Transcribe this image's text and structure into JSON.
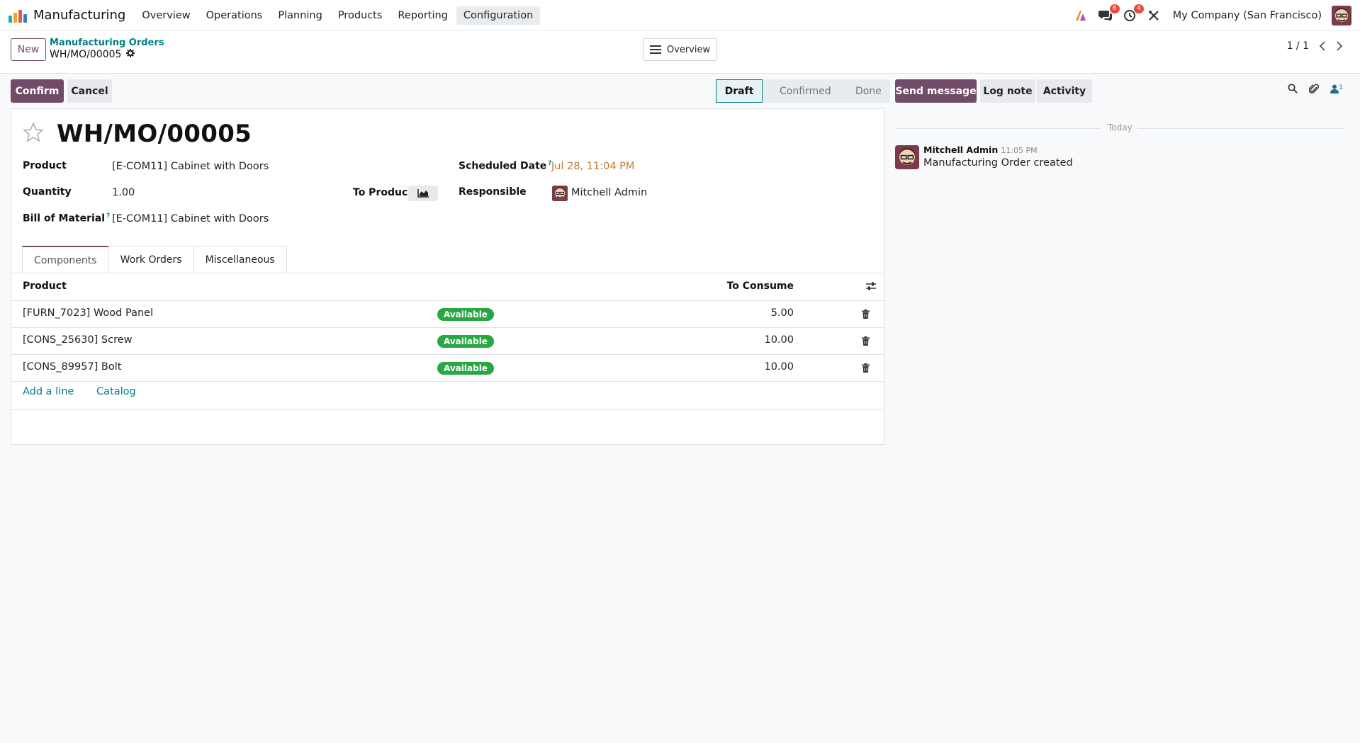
{
  "navbar": {
    "app_name": "Manufacturing",
    "menu": [
      "Overview",
      "Operations",
      "Planning",
      "Products",
      "Reporting",
      "Configuration"
    ],
    "active_menu": "Configuration",
    "messages_count": "6",
    "activities_count": "4",
    "company": "My Company (San Francisco)"
  },
  "control": {
    "new_label": "New",
    "breadcrumb_parent": "Manufacturing Orders",
    "breadcrumb_current": "WH/MO/00005",
    "overview_label": "Overview",
    "pager": "1 / 1"
  },
  "statusbar": {
    "confirm_label": "Confirm",
    "cancel_label": "Cancel",
    "stages": [
      "Draft",
      "Confirmed",
      "Done"
    ],
    "active_stage": "Draft"
  },
  "form": {
    "title": "WH/MO/00005",
    "product_label": "Product",
    "product_value": "[E-COM11] Cabinet with Doors",
    "quantity_label": "Quantity",
    "quantity_value": "1.00",
    "to_produce_label": "To Produce",
    "bom_label": "Bill of Material",
    "bom_value": "[E-COM11] Cabinet with Doors",
    "scheduled_label": "Scheduled Date",
    "scheduled_value": "Jul 28, 11:04 PM",
    "responsible_label": "Responsible",
    "responsible_value": "Mitchell Admin",
    "help_mark": "?"
  },
  "tabs": [
    "Components",
    "Work Orders",
    "Miscellaneous"
  ],
  "components": {
    "col_product": "Product",
    "col_to_consume": "To Consume",
    "rows": [
      {
        "product": "[FURN_7023] Wood Panel",
        "status": "Available",
        "qty": "5.00"
      },
      {
        "product": "[CONS_25630] Screw",
        "status": "Available",
        "qty": "10.00"
      },
      {
        "product": "[CONS_89957] Bolt",
        "status": "Available",
        "qty": "10.00"
      }
    ],
    "add_line": "Add a line",
    "catalog": "Catalog"
  },
  "chatter": {
    "send_message": "Send message",
    "log_note": "Log note",
    "activity": "Activity",
    "followers_count": "1",
    "date_separator": "Today",
    "message": {
      "author": "Mitchell Admin",
      "time": "11:05 PM",
      "body": "Manufacturing Order created"
    }
  },
  "colors": {
    "primary": "#714b67",
    "link": "#017e84",
    "success": "#28a745",
    "date_warning": "#c0792c"
  }
}
